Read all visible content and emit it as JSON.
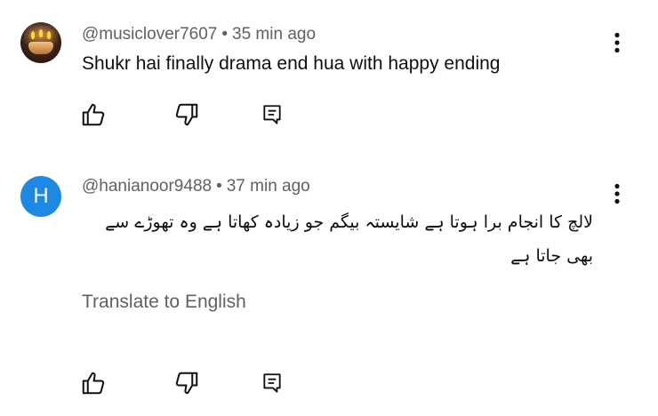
{
  "comments": [
    {
      "author": "@musiclover7607",
      "separator": "•",
      "time": "35 min ago",
      "text": "Shukr hai finally drama end hua with happy ending",
      "avatar": {
        "type": "photo"
      }
    },
    {
      "author": "@hanianoor9488",
      "separator": "•",
      "time": "37 min ago",
      "text": "لالچ کا انجام برا ہوتا ہے شایستہ بیگم جو زیادہ کھاتا ہے وہ تھوڑے سے بھی جاتا ہے",
      "avatar": {
        "type": "letter",
        "letter": "H",
        "color": "#1e88e5"
      },
      "translate_label": "Translate to English"
    }
  ],
  "icons": {
    "more": "more-vert-icon",
    "like": "thumb-up-icon",
    "dislike": "thumb-down-icon",
    "reply": "reply-comment-icon"
  },
  "colors": {
    "primary_text": "#0f0f0f",
    "secondary_text": "#606060",
    "avatar_blue": "#1e88e5"
  }
}
